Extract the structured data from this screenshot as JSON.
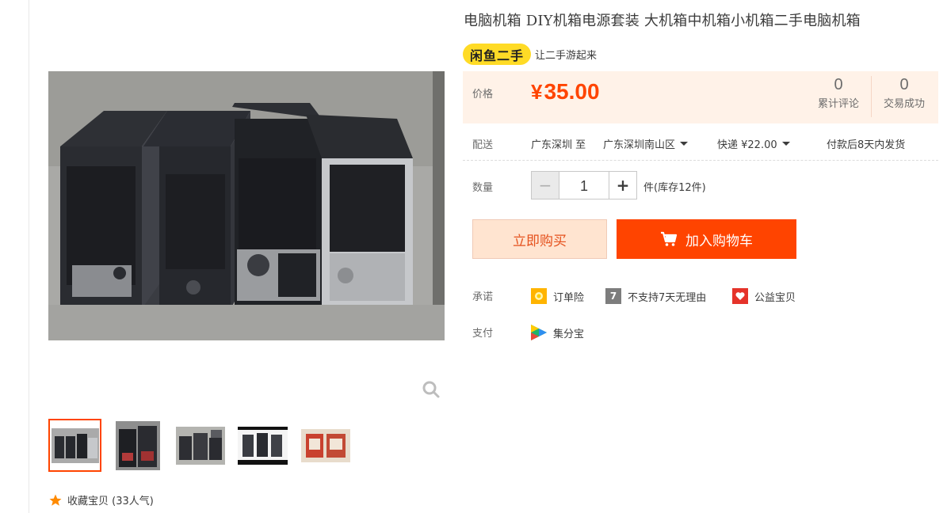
{
  "product": {
    "title": "电脑机箱 DIY机箱电源套装 大机箱中机箱小机箱二手电脑机箱",
    "badge": "闲鱼二手",
    "slogan": "让二手游起来"
  },
  "price_section": {
    "label": "价格",
    "currency": "¥",
    "price": "35.00",
    "reviews_count": "0",
    "reviews_label": "累计评论",
    "sales_count": "0",
    "sales_label": "交易成功",
    "accent_color": "#ff4400"
  },
  "shipping": {
    "label": "配送",
    "from": "广东深圳 至",
    "to": "广东深圳南山区",
    "method": "快递 ¥22.00",
    "delivery_note": "付款后8天内发货"
  },
  "quantity": {
    "label": "数量",
    "minus": "−",
    "value": "1",
    "plus": "+",
    "stock_note": "件(库存12件)"
  },
  "actions": {
    "buy_now": "立即购买",
    "add_to_cart": "加入购物车"
  },
  "promise": {
    "label": "承诺",
    "items": [
      {
        "label": "订单险",
        "icon": "order-insurance-icon"
      },
      {
        "label": "不支持7天无理由",
        "icon": "seven-day-icon",
        "icon_text": "7"
      },
      {
        "label": "公益宝贝",
        "icon": "charity-heart-icon"
      }
    ]
  },
  "payment": {
    "label": "支付",
    "items": [
      {
        "label": "集分宝",
        "icon": "jifenbao-icon"
      }
    ]
  },
  "gallery": {
    "thumbnail_count": 5,
    "active_index": 0,
    "zoom_icon": "search-icon"
  },
  "favorite": {
    "label": "收藏宝贝 (33人气)",
    "icon": "star-icon"
  }
}
